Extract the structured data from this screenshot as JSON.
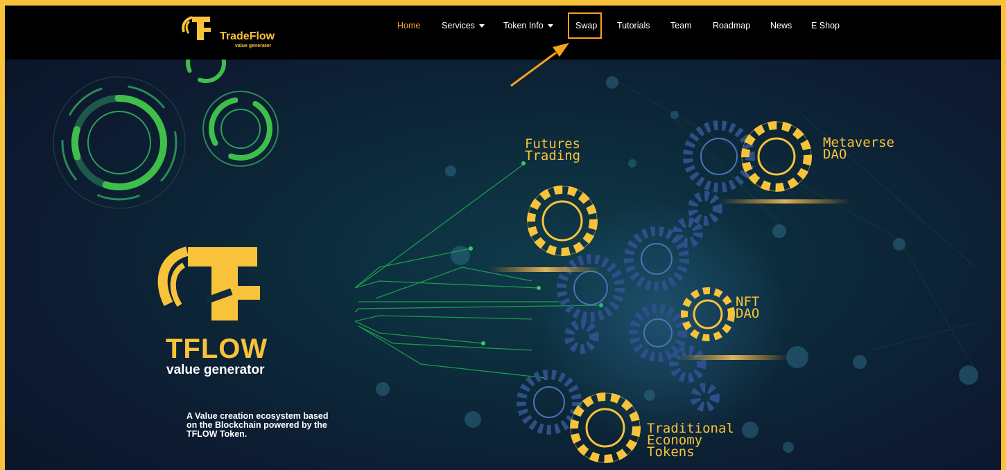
{
  "brand": {
    "name": "TradeFlow",
    "tagline": "value generator"
  },
  "nav": {
    "home": "Home",
    "services": "Services",
    "token_info": "Token Info",
    "swap": "Swap",
    "tutorials": "Tutorials",
    "team": "Team",
    "roadmap": "Roadmap",
    "news": "News",
    "eshop": "E Shop"
  },
  "hero": {
    "title": "TFLOW",
    "subtitle": "value generator",
    "description": "A Value creation ecosystem based on the Blockchain powered by the TFLOW Token."
  },
  "gears": {
    "futures": "Futures\nTrading",
    "metaverse": "Metaverse\nDAO",
    "nft": "NFT\nDAO",
    "traditional": "Traditional\nEconomy\nTokens"
  },
  "colors": {
    "frame": "#f8c33a",
    "accent": "#f8c33a",
    "active_nav": "#f0a030",
    "highlight": "#f8a21c",
    "nav_bg": "#000000"
  },
  "icons": {
    "logo": "tf-logo-icon",
    "caret": "caret-down-icon",
    "arrow": "arrow-pointer-icon"
  }
}
